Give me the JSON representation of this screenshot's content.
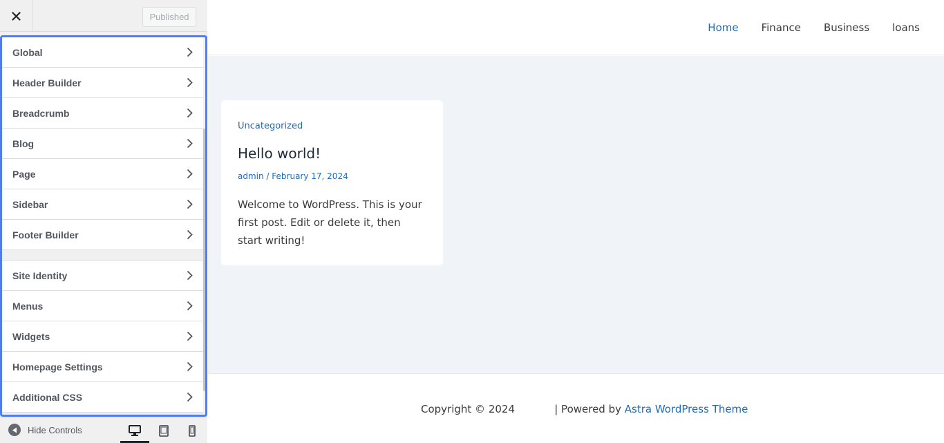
{
  "sidebar": {
    "publish_label": "Published",
    "sections_group1": [
      {
        "label": "Global"
      },
      {
        "label": "Header Builder"
      },
      {
        "label": "Breadcrumb"
      },
      {
        "label": "Blog"
      },
      {
        "label": "Page"
      },
      {
        "label": "Sidebar"
      },
      {
        "label": "Footer Builder"
      }
    ],
    "sections_group2": [
      {
        "label": "Site Identity"
      },
      {
        "label": "Menus"
      },
      {
        "label": "Widgets"
      },
      {
        "label": "Homepage Settings"
      },
      {
        "label": "Additional CSS"
      }
    ],
    "hide_controls_label": "Hide Controls"
  },
  "site": {
    "nav": [
      "Home",
      "Finance",
      "Business",
      "loans"
    ],
    "post": {
      "category": "Uncategorized",
      "title": "Hello world!",
      "author": "admin",
      "meta_sep": " / ",
      "date": "February 17, 2024",
      "excerpt": "Welcome to WordPress. This is your first post. Edit or delete it, then start writing!"
    },
    "footer": {
      "copyright": "Copyright © 2024",
      "powered_by": "| Powered by ",
      "theme_link": "Astra WordPress Theme"
    }
  },
  "colors": {
    "accent": "#1e6bb8",
    "panel_highlight": "#4f7df3",
    "content_bg": "#f0f4f8"
  }
}
